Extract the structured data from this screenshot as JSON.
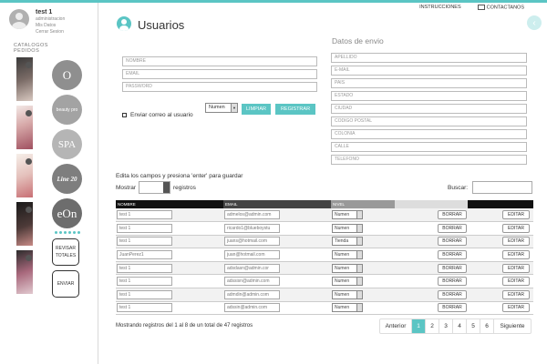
{
  "header": {
    "instrucciones": "INSTRUCCIONES",
    "contactanos": "CONTACTANOS"
  },
  "user": {
    "name": "test 1",
    "role": "administracion",
    "links": [
      "Mis Datos",
      "Cerrar Sesion"
    ]
  },
  "sidebar": {
    "tabs": [
      "CATALOGOS",
      "PEDIDOS"
    ],
    "brands": [
      "O",
      "beauty pro",
      "SPA",
      "Line 20",
      "eOn"
    ],
    "revisar_label": "REVISAR TOTALES",
    "enviar_label": "ENVIAR"
  },
  "page": {
    "title": "Usuarios",
    "datos_envio": "Datos de envio"
  },
  "form": {
    "left_placeholders": [
      "NOMBRE",
      "EMAIL",
      "PASSWORD"
    ],
    "right_placeholders": [
      "APELLIDO",
      "E-MAIL",
      "PAIS",
      "ESTADO",
      "CIUDAD",
      "CODIGO POSTAL",
      "COLONIA",
      "CALLE",
      "TELEFONO"
    ],
    "checkbox_label": "Enviar correo al usuario",
    "level_select": "Numen",
    "limpiar": "LIMPIAR",
    "registrar": "REGISTRAR"
  },
  "table": {
    "hint": "Edita los campos y presiona 'enter' para guardar",
    "mostrar": "Mostrar",
    "registros": "registros",
    "buscar": "Buscar:",
    "headers": [
      "NOMBRE",
      "EMAIL",
      "NIVEL",
      "",
      ""
    ],
    "rows": [
      {
        "nombre": "test 1",
        "email": "admelos@admin.com",
        "nivel": "Numen",
        "borrar": "BORRAR",
        "editar": "EDITAR"
      },
      {
        "nombre": "test 1",
        "email": "ricardo1@blueboystu",
        "nivel": "Numen",
        "borrar": "BORRAR",
        "editar": "EDITAR"
      },
      {
        "nombre": "test 1",
        "email": "juans@hotmail.com",
        "nivel": "Tienda",
        "borrar": "BORRAR",
        "editar": "EDITAR"
      },
      {
        "nombre": "JuanPerez1",
        "email": "juan@hotmail.com",
        "nivel": "Numen",
        "borrar": "BORRAR",
        "editar": "EDITAR"
      },
      {
        "nombre": "test 1",
        "email": "adsdasn@admin.cor",
        "nivel": "Numen",
        "borrar": "BORRAR",
        "editar": "EDITAR"
      },
      {
        "nombre": "test 1",
        "email": "adssisn@admin.com",
        "nivel": "Numen",
        "borrar": "BORRAR",
        "editar": "EDITAR"
      },
      {
        "nombre": "test 1",
        "email": "admdin@admin.com",
        "nivel": "Numen",
        "borrar": "BORRAR",
        "editar": "EDITAR"
      },
      {
        "nombre": "test 1",
        "email": "adssin@admin.com",
        "nivel": "Numen",
        "borrar": "BORRAR",
        "editar": "EDITAR"
      }
    ],
    "showing": "Mostrando registros del 1 al 8 de un total de 47 registros"
  },
  "pagination": {
    "prev": "Anterior",
    "pages": [
      "1",
      "2",
      "3",
      "4",
      "5",
      "6"
    ],
    "active_page": "1",
    "next": "Siguiente"
  },
  "colors": {
    "accent": "#5bc5c4",
    "header_dark": "#111111"
  },
  "icons": [
    "user-avatar-icon",
    "mail-icon",
    "users-icon",
    "back-arrow-icon"
  ]
}
